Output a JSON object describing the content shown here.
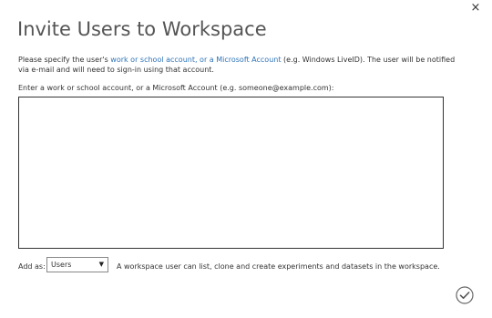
{
  "dialog": {
    "title": "Invite Users to Workspace",
    "close_glyph": "×",
    "description": {
      "before_link": "Please specify the user's ",
      "link": "work or school account, or a Microsoft Account",
      "after_link": " (e.g. Windows LiveID). The user will be notified via e-mail and will need to sign-in using that account."
    },
    "prompt": "Enter a work or school account, or a Microsoft Account (e.g. someone@example.com):",
    "accounts_value": "",
    "add_as": {
      "label": "Add as:",
      "selected": "Users",
      "help": "A workspace user can list, clone and create experiments and datasets in the workspace."
    },
    "icons": {
      "close": "close-icon",
      "confirm": "checkmark-circle-icon",
      "dropdown": "caret-down-icon"
    },
    "colors": {
      "link": "#2e73b8",
      "title": "#555555",
      "border": "#333333"
    }
  }
}
